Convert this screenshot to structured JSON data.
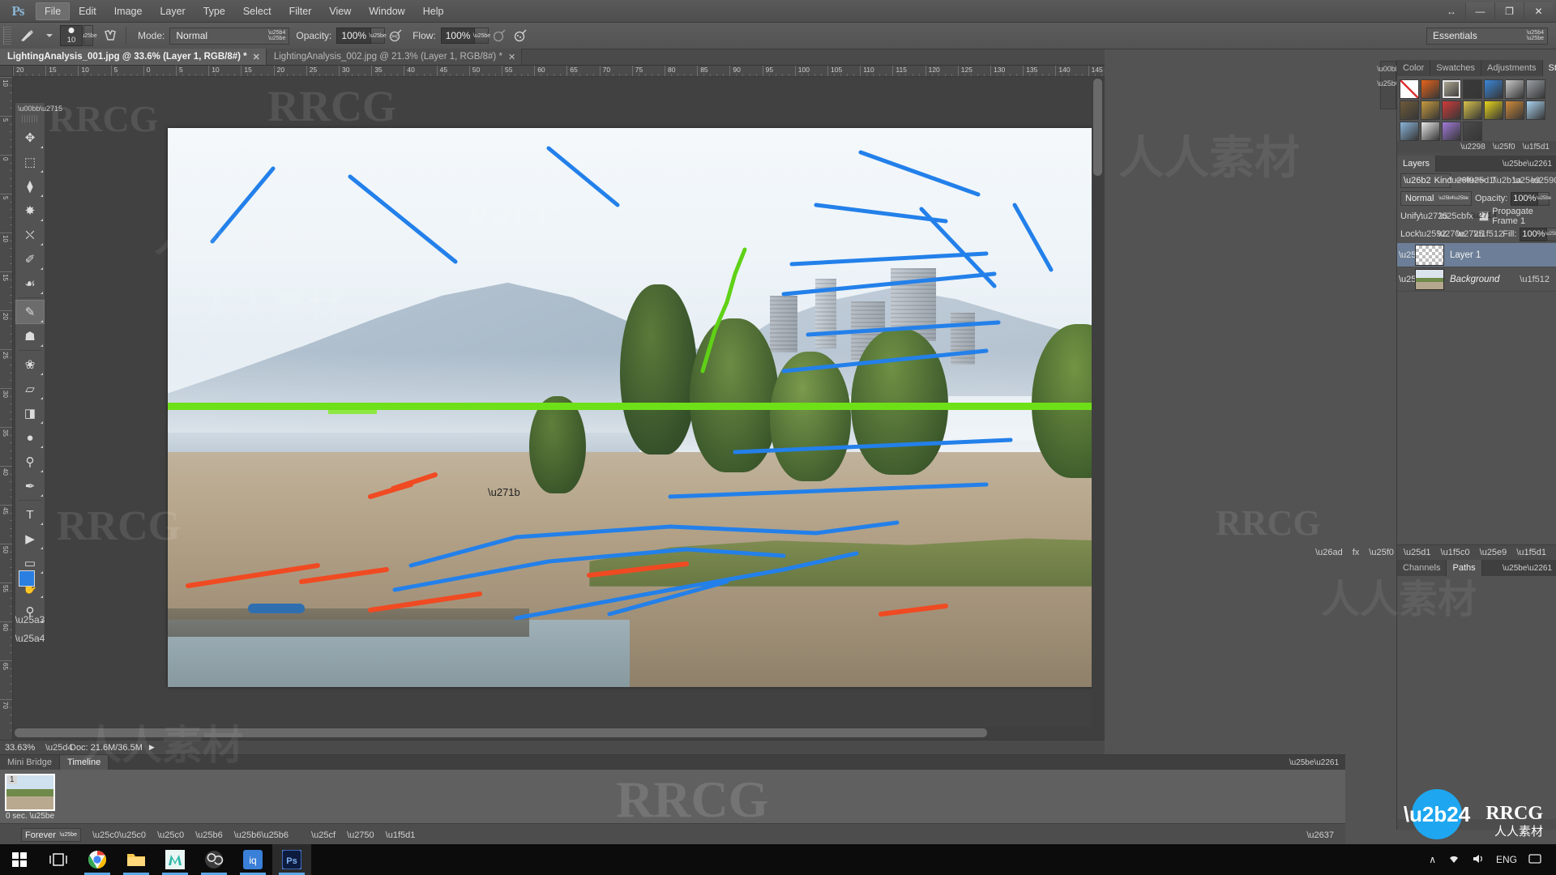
{
  "app": {
    "name": "Adobe Photoshop",
    "logo": "Ps"
  },
  "menu": {
    "items": [
      "File",
      "Edit",
      "Image",
      "Layer",
      "Type",
      "Select",
      "Filter",
      "View",
      "Window",
      "Help"
    ],
    "active": "File",
    "window_controls": {
      "minimize": "—",
      "restore": "❐",
      "close": "✕"
    },
    "arrange_icon": "↔"
  },
  "options_bar": {
    "brush_preview_icon": "brush-icon",
    "brush_size": "10",
    "airbrush_toggle_icon": "tablet-pressure-icon",
    "mode_label": "Mode:",
    "mode_value": "Normal",
    "opacity_label": "Opacity:",
    "opacity_value": "100%",
    "opacity_pressure_icon": "pressure-opacity-icon",
    "flow_label": "Flow:",
    "flow_value": "100%",
    "flow_pressure_icon": "pressure-flow-icon",
    "airbrush_icon": "airbrush-icon",
    "workspace_value": "Essentials"
  },
  "document_tabs": [
    {
      "label": "LightingAnalysis_001.jpg @ 33.6% (Layer 1, RGB/8#) *",
      "active": true,
      "close": "✕"
    },
    {
      "label": "LightingAnalysis_002.jpg @ 21.3% (Layer 1, RGB/8#) *",
      "active": false,
      "close": "✕"
    }
  ],
  "rulers": {
    "horizontal_ticks": [
      "20",
      "15",
      "10",
      "5",
      "0",
      "5",
      "10",
      "15",
      "20",
      "25",
      "30",
      "35",
      "40",
      "45",
      "50",
      "55",
      "60",
      "65",
      "70",
      "75",
      "80",
      "85",
      "90",
      "95",
      "100",
      "105",
      "110",
      "115",
      "120",
      "125",
      "130",
      "135",
      "140",
      "145"
    ],
    "vertical_ticks": [
      "10",
      "5",
      "0",
      "5",
      "10",
      "15",
      "20",
      "25",
      "30",
      "35",
      "40",
      "45",
      "50",
      "55",
      "60",
      "65",
      "70"
    ],
    "unit": "inches"
  },
  "tools": [
    {
      "name": "move-tool",
      "glyph": "✥"
    },
    {
      "name": "rectangular-marquee-tool",
      "glyph": "⬚"
    },
    {
      "name": "lasso-tool",
      "glyph": "⧫"
    },
    {
      "name": "quick-selection-tool",
      "glyph": "✸"
    },
    {
      "name": "crop-tool",
      "glyph": "⛌"
    },
    {
      "name": "eyedropper-tool",
      "glyph": "✐"
    },
    {
      "name": "spot-healing-brush-tool",
      "glyph": "☙"
    },
    {
      "name": "brush-tool",
      "glyph": "✎",
      "selected": true
    },
    {
      "name": "clone-stamp-tool",
      "glyph": "☗"
    },
    {
      "name": "history-brush-tool",
      "glyph": "❀"
    },
    {
      "name": "eraser-tool",
      "glyph": "▱"
    },
    {
      "name": "gradient-tool",
      "glyph": "◨"
    },
    {
      "name": "blur-tool",
      "glyph": "●"
    },
    {
      "name": "dodge-tool",
      "glyph": "⚲"
    },
    {
      "name": "pen-tool",
      "glyph": "✒"
    },
    {
      "name": "horizontal-type-tool",
      "glyph": "T"
    },
    {
      "name": "path-selection-tool",
      "glyph": "▶"
    },
    {
      "name": "rectangle-tool",
      "glyph": "▭"
    },
    {
      "name": "hand-tool",
      "glyph": "✋"
    },
    {
      "name": "zoom-tool",
      "glyph": "⚲"
    }
  ],
  "tool_colors": {
    "foreground": "#2a7fe0",
    "background": "#ffffff"
  },
  "canvas": {
    "zoom": "33.63%",
    "image_description": "Beach landscape with mountains, trees, buildings and people, overlaid with lighting analysis annotation strokes",
    "annotation_colors": {
      "blue": "#2380ea",
      "red": "#f04a22",
      "green": "#6ee018"
    },
    "horizon_line_label": "horizon-guide"
  },
  "right_dock": {
    "top_panel": {
      "tabs": [
        "Color",
        "Swatches",
        "Adjustments",
        "Styles"
      ],
      "active_tab": "Styles",
      "menu_icon": "panel-menu-icon",
      "style_swatches": [
        {
          "name": "none",
          "color": "#ffffff",
          "selected": false
        },
        {
          "name": "orange-glow",
          "color": "#e8631a",
          "selected": false
        },
        {
          "name": "beveled-frame",
          "color": "#b5b09a",
          "selected": true
        },
        {
          "name": "dark-texture",
          "color": "#3a3a3a",
          "selected": false
        },
        {
          "name": "blue-gel",
          "color": "#3a86d8",
          "selected": false
        },
        {
          "name": "silver-plate",
          "color": "#c8c8c8",
          "selected": false
        },
        {
          "name": "chrome",
          "color": "#9aa0a6",
          "selected": false
        },
        {
          "name": "soft-amber",
          "color": "#6e5b3a",
          "selected": false
        },
        {
          "name": "golden",
          "color": "#c79a3d",
          "selected": false
        },
        {
          "name": "red-stripe",
          "color": "#d03b3b",
          "selected": false
        },
        {
          "name": "confetti",
          "color": "#d8c14a",
          "selected": false
        },
        {
          "name": "yellow-plastic",
          "color": "#e8d41a",
          "selected": false
        },
        {
          "name": "copper",
          "color": "#d08a3a",
          "selected": false
        },
        {
          "name": "sky-blue",
          "color": "#a9d2f0",
          "selected": false
        },
        {
          "name": "sunset",
          "color": "#8ab4d8",
          "selected": false
        },
        {
          "name": "noise-white",
          "color": "#e6e6e6",
          "selected": false
        },
        {
          "name": "violet-block",
          "color": "#a07ad8",
          "selected": false
        },
        {
          "name": "line-bottom",
          "color": "#4a4a4a",
          "selected": false
        }
      ],
      "footer_icons": [
        "clear-style-icon",
        "new-style-icon",
        "delete-style-icon"
      ]
    },
    "layers_panel": {
      "tab_label": "Layers",
      "menu_icon": "panel-menu-icon",
      "filter": {
        "search_icon": "search-icon",
        "kind_label": "Kind",
        "type_icons": [
          "pixel-filter-icon",
          "adjustment-filter-icon",
          "type-filter-icon",
          "shape-filter-icon",
          "smart-object-filter-icon"
        ],
        "toggle_icon": "filter-toggle-icon"
      },
      "blend_mode": "Normal",
      "opacity_label": "Opacity:",
      "opacity_value": "100%",
      "unify_label": "Unify:",
      "unify_icons": [
        "unify-position-icon",
        "unify-visibility-icon",
        "unify-style-icon"
      ],
      "propagate_label": "Propagate Frame 1",
      "propagate_checked": true,
      "lock_label": "Lock:",
      "lock_icons": [
        "lock-transparency-icon",
        "lock-image-icon",
        "lock-position-icon",
        "lock-all-icon"
      ],
      "fill_label": "Fill:",
      "fill_value": "100%",
      "layers": [
        {
          "name": "Layer 1",
          "visible": true,
          "selected": true,
          "locked": false,
          "thumb": "checker",
          "italic": false
        },
        {
          "name": "Background",
          "visible": true,
          "selected": false,
          "locked": true,
          "thumb": "photo",
          "italic": true
        }
      ],
      "footer_icons": [
        "link-layers-icon",
        "add-layer-style-icon",
        "add-layer-mask-icon",
        "new-adjustment-layer-icon",
        "new-group-icon",
        "new-layer-icon",
        "delete-layer-icon"
      ]
    },
    "bottom_panel": {
      "tabs": [
        "Channels",
        "Paths"
      ],
      "active_tab": "Paths",
      "menu_icon": "panel-menu-icon"
    }
  },
  "status_bar": {
    "zoom": "33.63%",
    "preview_icon": "proof-preview-icon",
    "doc_info": "Doc: 21.6M/36.5M",
    "expand_icon": "▶"
  },
  "bottom_dock": {
    "tabs": [
      "Mini Bridge",
      "Timeline"
    ],
    "active_tab": "Timeline",
    "menu_icon": "panel-menu-icon",
    "frames": [
      {
        "number": "1",
        "duration": "0 sec."
      }
    ],
    "loop_value": "Forever",
    "controls": [
      "select-first-frame-icon",
      "select-previous-frame-icon",
      "play-animation-icon",
      "select-next-frame-icon",
      "tween-icon",
      "duplicate-frame-icon",
      "delete-frame-icon",
      "convert-to-timeline-icon"
    ]
  },
  "taskbar": {
    "start_icon": "windows-start-icon",
    "task_view_icon": "task-view-icon",
    "apps": [
      {
        "name": "google-chrome",
        "label": "Chrome",
        "color": "#4285f4",
        "running": true
      },
      {
        "name": "file-explorer",
        "label": "File Explorer",
        "color": "#ffc84a",
        "running": true
      },
      {
        "name": "autodesk-maya",
        "label": "Maya",
        "color": "#2eb8a8",
        "running": true
      },
      {
        "name": "obs-studio",
        "label": "OBS Studio",
        "color": "#8a8a8a",
        "running": true
      },
      {
        "name": "iq-app",
        "label": "IQ",
        "color": "#3a7fd8",
        "running": true
      },
      {
        "name": "adobe-photoshop",
        "label": "Photoshop",
        "color": "#2b5b9e",
        "running": true,
        "active": true
      }
    ],
    "tray": {
      "chevron": "∧",
      "network_icon": "wifi-icon",
      "volume_icon": "speaker-icon",
      "language": "ENG",
      "action_center_icon": "notification-icon"
    }
  },
  "watermarks": {
    "latin": "RRCG",
    "cjk": "人人素材"
  }
}
